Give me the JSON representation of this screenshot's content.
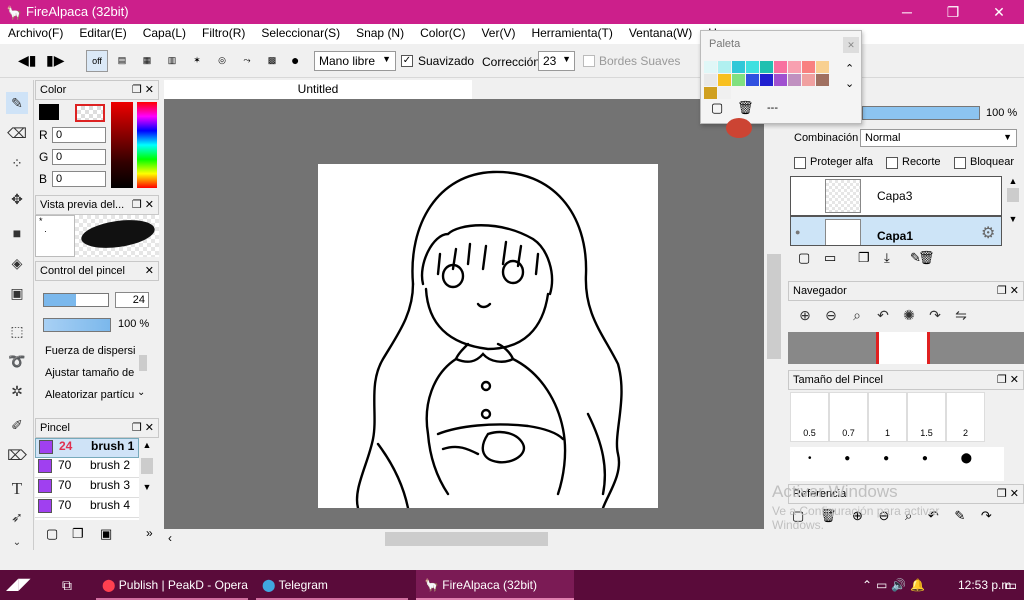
{
  "window": {
    "title": "FireAlpaca (32bit)"
  },
  "menu": [
    "Archivo(F)",
    "Editar(E)",
    "Capa(L)",
    "Filtro(R)",
    "Seleccionar(S)",
    "Snap (N)",
    "Color(C)",
    "Ver(V)",
    "Herramienta(T)",
    "Ventana(W)",
    "He"
  ],
  "toolbar": {
    "off": "off",
    "mode": "Mano libre",
    "smooth": "Suavizado",
    "correction_label": "Corrección",
    "correction_value": "23",
    "edges": "Bordes Suaves"
  },
  "color_panel": {
    "title": "Color",
    "r_label": "R",
    "r": "0",
    "g_label": "G",
    "g": "0",
    "b_label": "B",
    "b": "0"
  },
  "preview_panel": {
    "title": "Vista previa del..."
  },
  "brush_control": {
    "title": "Control del pincel",
    "size": "24",
    "opacity": "100 %",
    "items": [
      "Fuerza de dispersi",
      "Ajustar tamaño de",
      "Aleatorizar partícu"
    ]
  },
  "brush_panel": {
    "title": "Pincel",
    "items": [
      {
        "size": "24",
        "name": "brush 1"
      },
      {
        "size": "70",
        "name": "brush 2"
      },
      {
        "size": "70",
        "name": "brush 3"
      },
      {
        "size": "70",
        "name": "brush 4"
      }
    ]
  },
  "canvas": {
    "tab": "Untitled"
  },
  "palette": {
    "title": "Paleta",
    "dash": "---",
    "colors": [
      "#e0f7f7",
      "#b0f0f0",
      "#30c8d8",
      "#40e0e0",
      "#20c0b0",
      "#f870a0",
      "#f8a0b0",
      "#f88080",
      "#f8d090",
      "#e8e8e8",
      "#f8c020",
      "#80e080",
      "#3050e0",
      "#2020d0",
      "#a050d0",
      "#c090c0",
      "#f0a0a0",
      "#a07060",
      "#d0a020",
      "#f0f0f0"
    ]
  },
  "layer_panel": {
    "opacity": "100 %",
    "blend_label": "Combinación",
    "blend": "Normal",
    "protect": "Proteger alfa",
    "clip": "Recorte",
    "lock": "Bloquear",
    "layers": [
      "Capa3",
      "Capa1"
    ]
  },
  "navigator": {
    "title": "Navegador"
  },
  "brush_size": {
    "title": "Tamaño del Pincel",
    "sizes": [
      "0.5",
      "0.7",
      "1",
      "1.5",
      "2"
    ]
  },
  "reference": {
    "title": "Referencia"
  },
  "watermark": {
    "line1": "Activar Windows",
    "line2": "Ve a Configuración para activar",
    "line3": "Windows."
  },
  "taskbar": {
    "opera": "Publish | PeakD - Opera",
    "telegram": "Telegram",
    "firealpaca": "FireAlpaca (32bit)",
    "time": "12:53 p.m."
  }
}
